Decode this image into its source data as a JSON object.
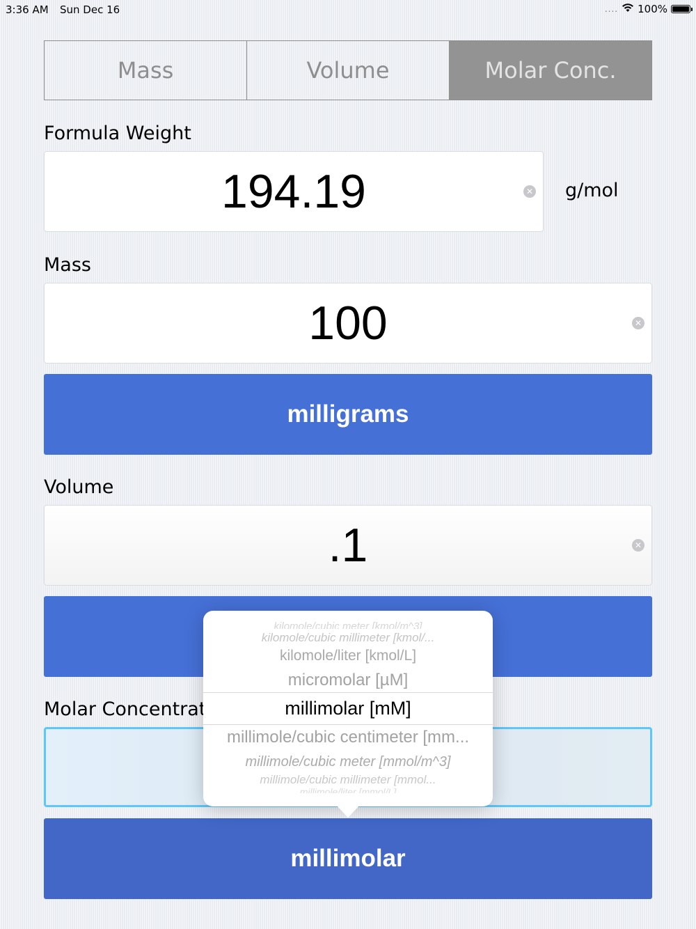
{
  "status": {
    "time": "3:36 AM",
    "date": "Sun Dec 16",
    "battery": "100%",
    "signal": "....",
    "wifi_icon": "wifi-icon"
  },
  "tabs": [
    {
      "label": "Mass",
      "active": false
    },
    {
      "label": "Volume",
      "active": false
    },
    {
      "label": "Molar Conc.",
      "active": true
    }
  ],
  "formula_weight": {
    "label": "Formula Weight",
    "value": "194.19",
    "unit": "g/mol"
  },
  "mass": {
    "label": "Mass",
    "value": "100",
    "unit_button": "milligrams"
  },
  "volume": {
    "label": "Volume",
    "value": ".1"
  },
  "molar": {
    "label": "Molar Concentrati",
    "value": "",
    "unit_button": "millimolar"
  },
  "picker": {
    "items": [
      "kilomole/cubic meter [kmol/m^3]",
      "kilomole/cubic millimeter [kmol/...",
      "kilomole/liter [kmol/L]",
      "micromolar [µM]",
      "millimolar [mM]",
      "millimole/cubic centimeter [mm...",
      "millimole/cubic meter [mmol/m^3]",
      "millimole/cubic millimeter [mmol...",
      "millimole/liter [mmol/L]"
    ],
    "selected_index": 4
  },
  "colors": {
    "accent": "#4570d6",
    "segment_active": "#939393",
    "focus_border": "#5ac8fa"
  }
}
